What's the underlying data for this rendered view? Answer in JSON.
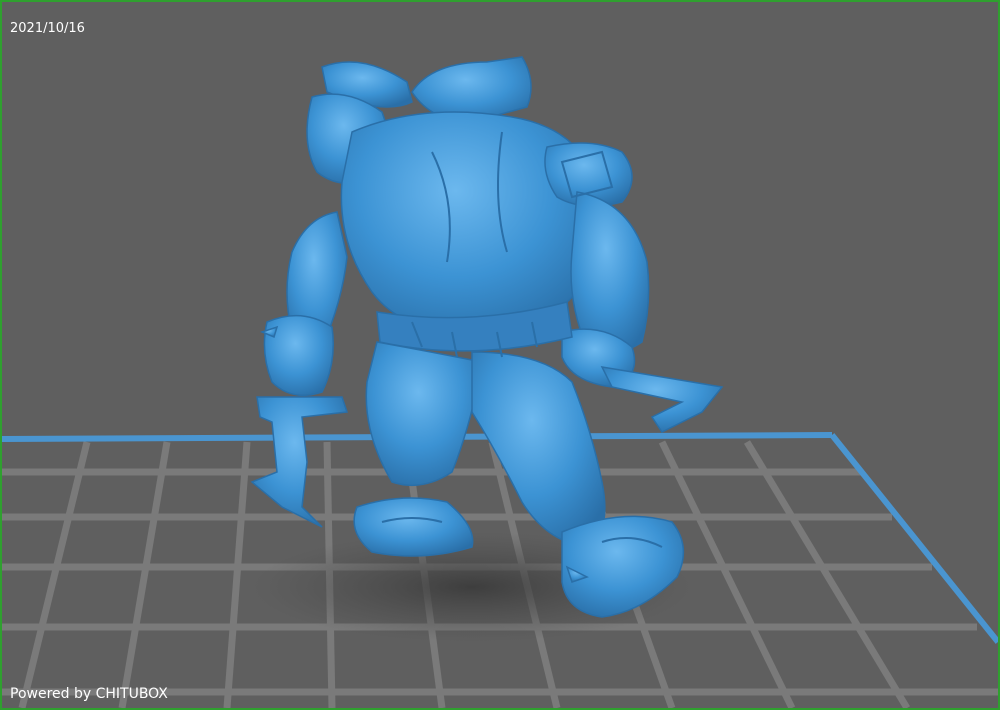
{
  "viewport": {
    "date": "2021/10/16",
    "powered_by": "Powered by CHITUBOX"
  },
  "scene": {
    "model_name_icon": "miniature-model",
    "model_color": "#3c93d4",
    "model_highlight": "#6cb8ee",
    "model_shadow": "#2a6fa8",
    "plate_border_color": "#4a95d0",
    "grid_color": "#7a7a7a",
    "background_color": "#5f5f5f",
    "frame_color": "#2fa02f"
  }
}
